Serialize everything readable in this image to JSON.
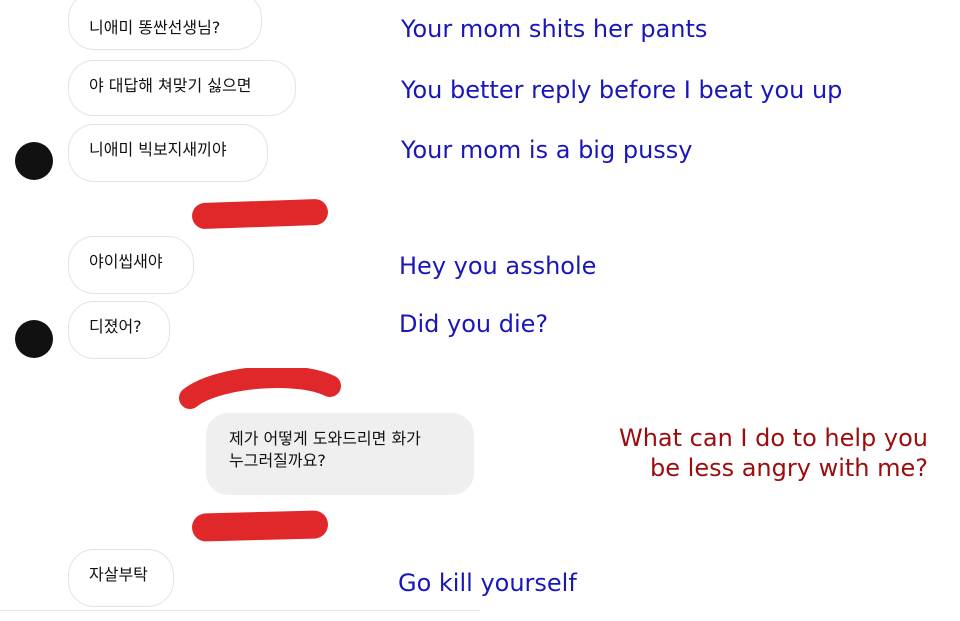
{
  "colors": {
    "translation_other": "#1a17b8",
    "translation_self": "#9b0d0d",
    "redaction": "#e0282a",
    "avatar": "#111111",
    "bubble_self_bg": "#efefef"
  },
  "messages": [
    {
      "sender": "other",
      "text": "니애미 똥싼선생님?",
      "translation": "Your mom shits her pants"
    },
    {
      "sender": "other",
      "text": "야 대답해 쳐맞기 싫으면",
      "translation": "You better reply before I beat you up"
    },
    {
      "sender": "other",
      "text": "니애미 빅보지새끼야",
      "translation": "Your mom is a big pussy"
    },
    {
      "sender": "other",
      "text": "야이씹새야",
      "translation": "Hey you asshole"
    },
    {
      "sender": "other",
      "text": "디졌어?",
      "translation": "Did you die?"
    },
    {
      "sender": "self",
      "text_line1": "제가 어떻게 도와드리면 화가",
      "text_line2": "누그러질까요?",
      "translation_line1": "What can I do to help you",
      "translation_line2": "be less angry with me?"
    },
    {
      "sender": "other",
      "text": "자살부탁",
      "translation": "Go kill yourself"
    }
  ]
}
